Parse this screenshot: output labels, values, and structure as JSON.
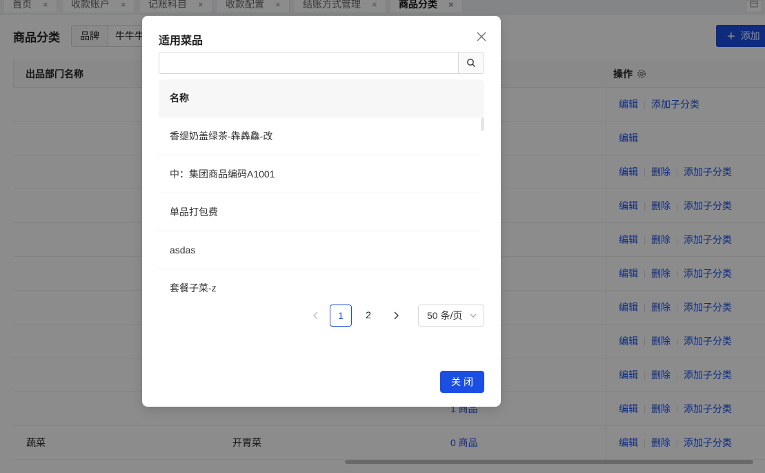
{
  "tabs": [
    {
      "label": "首页"
    },
    {
      "label": "收款账户"
    },
    {
      "label": "记账科目"
    },
    {
      "label": "收款配置"
    },
    {
      "label": "结账方式管理"
    },
    {
      "label": "商品分类"
    }
  ],
  "tab_close_glyph": "×",
  "page": {
    "title": "商品分类",
    "filter_label": "品牌",
    "filter_value": "牛牛牛",
    "add_button": "添加"
  },
  "table": {
    "col_department": "出品部门名称",
    "col_operation": "操作",
    "actions": {
      "edit": "编辑",
      "delete": "删除",
      "add_child": "添加子分类"
    },
    "rows": [
      {
        "ops": [
          "edit",
          "add_child"
        ]
      },
      {
        "ops": [
          "edit"
        ]
      },
      {
        "ops": [
          "edit",
          "delete",
          "add_child"
        ]
      },
      {
        "ops": [
          "edit",
          "delete",
          "add_child"
        ]
      },
      {
        "ops": [
          "edit",
          "delete",
          "add_child"
        ]
      },
      {
        "ops": [
          "edit",
          "delete",
          "add_child"
        ]
      },
      {
        "ops": [
          "edit",
          "delete",
          "add_child"
        ]
      },
      {
        "ops": [
          "edit",
          "delete",
          "add_child"
        ]
      },
      {
        "ops": [
          "edit",
          "delete",
          "add_child"
        ]
      },
      {
        "count": "1 商品",
        "ops": [
          "edit",
          "delete",
          "add_child"
        ]
      },
      {
        "department": "蔬菜",
        "name": "开胃菜",
        "count": "0 商品",
        "ops": [
          "edit",
          "delete",
          "add_child"
        ]
      }
    ]
  },
  "modal": {
    "title": "适用菜品",
    "search_value": "",
    "column_name": "名称",
    "items": [
      "香缇奶盖绿茶-犇羴鱻-改",
      "中：集团商品编码A1001",
      "单品打包费",
      "asdas",
      "套餐子菜-z"
    ],
    "pagination": {
      "pages": [
        "1",
        "2"
      ],
      "current": "1",
      "page_size": "50 条/页"
    },
    "close_button": "关闭"
  }
}
